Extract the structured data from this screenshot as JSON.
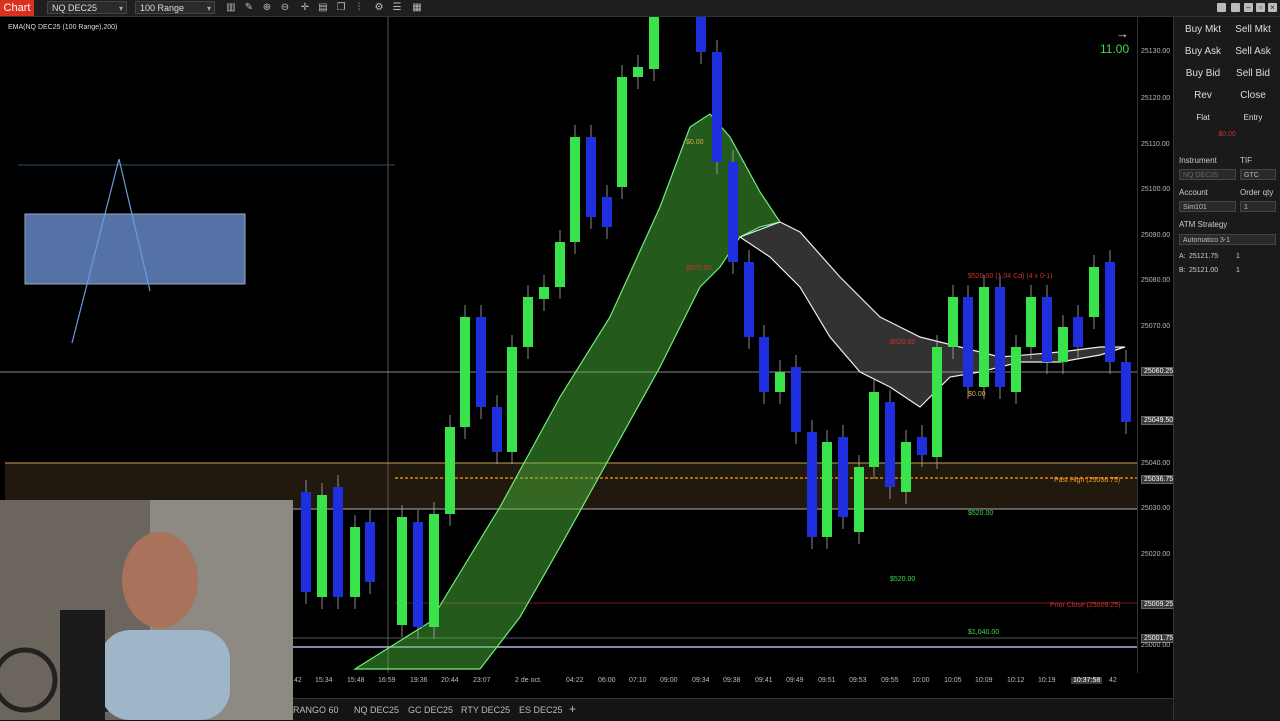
{
  "toolbar": {
    "chart_tab": "Chart",
    "instrument": "NQ DEC25",
    "bar_type": "100 Range",
    "icons": [
      "bar-style-icon",
      "draw-icon",
      "zoom-in-icon",
      "zoom-out-icon",
      "crosshair-icon",
      "properties-icon",
      "copy-icon",
      "bars-icon",
      "strategy-icon",
      "list-icon",
      "grid-icon"
    ]
  },
  "indicator_label": "EMA(NQ DEC25 (100 Range),200)",
  "timer": "11.00",
  "y_axis": {
    "labels": [
      "25130.00",
      "25120.00",
      "25110.00",
      "25100.00",
      "25090.00",
      "25080.00",
      "25070.00",
      "25060.25",
      "25049.50",
      "25040.00",
      "25036.75",
      "25030.00",
      "25020.00",
      "25009.25",
      "25001.75",
      "25000.00"
    ]
  },
  "x_axis": {
    "labels": [
      "42",
      "15:34",
      "15:48",
      "16:59",
      "19:36",
      "20:44",
      "23:07",
      "2 de oct.",
      "04:22",
      "06:00",
      "07:10",
      "09:00",
      "09:34",
      "09:38",
      "09:41",
      "09:49",
      "09:51",
      "09:53",
      "09:55",
      "10:00",
      "10:05",
      "10:09",
      "10:12",
      "10:19",
      "10:37:58",
      "42"
    ]
  },
  "chart_overlays": {
    "pnl_top": "$0.00",
    "pnl_red_left": "$520.00",
    "pnl_red_right": "$520.00 (1.04 Cd) (4 x 0-1)",
    "pnl_mid_red": "$520.00",
    "pnl_zero2": "$0.00",
    "pnl_520": "$520.00",
    "pnl_520b": "$520.00",
    "pnl_1040": "$1,040.00",
    "past_high": "Past High (25036.75)",
    "prior_close": "Prior Close (25009.25)"
  },
  "bottom_tabs": [
    "RANGO 60",
    "NQ DEC25",
    "GC DEC25",
    "RTY DEC25",
    "ES DEC25"
  ],
  "order_panel": {
    "buttons": [
      [
        "Buy Mkt",
        "Sell Mkt"
      ],
      [
        "Buy Ask",
        "Sell Ask"
      ],
      [
        "Buy Bid",
        "Sell Bid"
      ],
      [
        "Rev",
        "Close"
      ]
    ],
    "flat": "Flat",
    "entry": "Entry",
    "pnl": "$0.00",
    "instrument_label": "Instrument",
    "tif_label": "TIF",
    "instrument_value": "NQ DEC25",
    "tif_value": "GTC",
    "account_label": "Account",
    "order_qty_label": "Order qty",
    "account_value": "Sim101",
    "qty_value": "1",
    "atm_label": "ATM Strategy",
    "atm_value": "Automatico 3-1",
    "ask_label": "A:",
    "ask_price": "25121.75",
    "ask_qty": "1",
    "bid_label": "B:",
    "bid_price": "25121.00",
    "bid_qty": "1"
  },
  "colors": {
    "up": "#39e34b",
    "down": "#1f2fe0",
    "accent": "#d9301f"
  }
}
